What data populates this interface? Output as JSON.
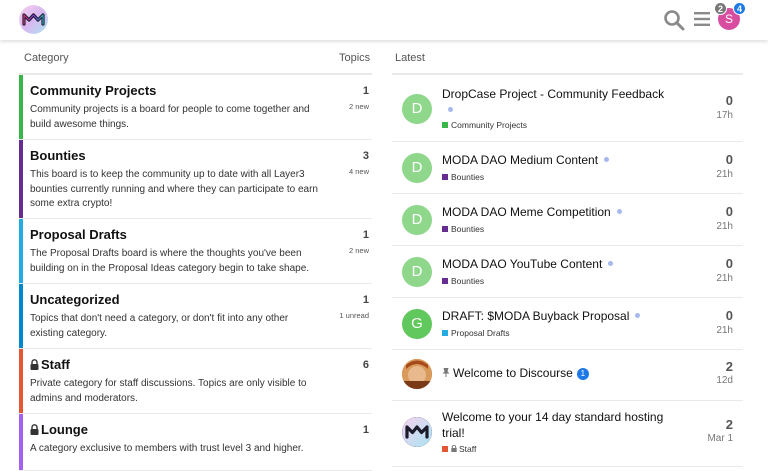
{
  "header": {
    "logo_icon": "moda-logo-icon",
    "search_icon": "search-icon",
    "menu_icon": "hamburger-menu-icon",
    "user_initial": "S",
    "user_color": "#d84da0",
    "badge_gray": "2",
    "badge_blue": "4"
  },
  "category_list": {
    "header_category": "Category",
    "header_topics": "Topics",
    "items": [
      {
        "name": "Community Projects",
        "desc": "Community projects is a board for people to come together and build awesome things.",
        "count": "1",
        "sub": "2 new",
        "color": "#3ab54a",
        "locked": false
      },
      {
        "name": "Bounties",
        "desc": "This board is to keep the community up to date with all Layer3 bounties currently running and where they can participate to earn some extra crypto!",
        "count": "3",
        "sub": "4 new",
        "color": "#652d90",
        "locked": false
      },
      {
        "name": "Proposal Drafts",
        "desc": "The Proposal Drafts board is where the thoughts you've been building on in the Proposal Ideas category begin to take shape.",
        "count": "1",
        "sub": "2 new",
        "color": "#25aae2",
        "locked": false
      },
      {
        "name": "Uncategorized",
        "desc": "Topics that don't need a category, or don't fit into any other existing category.",
        "count": "1",
        "sub": "1 unread",
        "color": "#0088cc",
        "locked": false
      },
      {
        "name": "Staff",
        "desc": "Private category for staff discussions. Topics are only visible to admins and moderators.",
        "count": "6",
        "sub": "",
        "color": "#e45735",
        "locked": true
      },
      {
        "name": "Lounge",
        "desc": "A category exclusive to members with trust level 3 and higher.",
        "count": "1",
        "sub": "",
        "color": "#a461ef",
        "locked": true
      }
    ]
  },
  "latest_list": {
    "header": "Latest",
    "items": [
      {
        "title": "DropCase Project - Community Feedback",
        "category": "Community Projects",
        "cat_color": "#3ab54a",
        "replies": "0",
        "age": "17h",
        "avatar": "D",
        "avatar_color": "#8ed78b",
        "new": true
      },
      {
        "title": "MODA DAO Medium Content",
        "category": "Bounties",
        "cat_color": "#652d90",
        "replies": "0",
        "age": "21h",
        "avatar": "D",
        "avatar_color": "#8ed78b",
        "new": true
      },
      {
        "title": "MODA DAO Meme Competition",
        "category": "Bounties",
        "cat_color": "#652d90",
        "replies": "0",
        "age": "21h",
        "avatar": "D",
        "avatar_color": "#8ed78b",
        "new": true
      },
      {
        "title": "MODA DAO YouTube Content",
        "category": "Bounties",
        "cat_color": "#652d90",
        "replies": "0",
        "age": "21h",
        "avatar": "D",
        "avatar_color": "#8ed78b",
        "new": true
      },
      {
        "title": "DRAFT: $MODA Buyback Proposal",
        "category": "Proposal Drafts",
        "cat_color": "#25aae2",
        "replies": "0",
        "age": "21h",
        "avatar": "G",
        "avatar_color": "#60c85d",
        "new": true
      },
      {
        "title": "Welcome to Discourse",
        "category": "",
        "cat_color": "",
        "replies": "2",
        "age": "12d",
        "avatar": "",
        "avatar_color": "#c96b2c",
        "new": false,
        "pinned": true,
        "unread": "1"
      },
      {
        "title": "Welcome to your 14 day standard hosting trial!",
        "category": "Staff",
        "cat_color": "#e45735",
        "replies": "2",
        "age": "Mar 1",
        "avatar": "",
        "avatar_color": "#2b2144",
        "new": false,
        "locked_cat": true
      }
    ]
  }
}
